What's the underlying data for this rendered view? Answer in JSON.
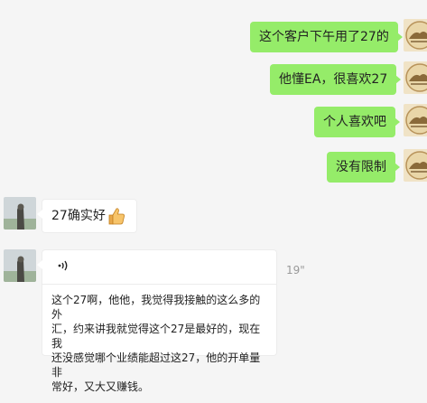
{
  "messages": [
    {
      "id": "m1",
      "side": "out",
      "text": "这个客户下午用了27的"
    },
    {
      "id": "m2",
      "side": "out",
      "text": "他懂EA，很喜欢27"
    },
    {
      "id": "m3",
      "side": "out",
      "text": "个人喜欢吧"
    },
    {
      "id": "m4",
      "side": "out",
      "text": "没有限制"
    },
    {
      "id": "m5",
      "side": "in",
      "text": "27确实好",
      "emoji": "thumbs-up-icon"
    },
    {
      "id": "m6",
      "side": "in",
      "type": "voice",
      "duration": "19\"",
      "transcript": "这个27啊，他他，我觉得我接触的这么多的外\n汇，约来讲我就觉得这个27是最好的，现在我\n还没感觉哪个业绩能超过这27，他的开单量非\n常好，又大又赚钱。"
    }
  ],
  "colors": {
    "outgoing_bubble": "#95ec69",
    "incoming_bubble": "#ffffff",
    "background": "#f5f5f5"
  }
}
